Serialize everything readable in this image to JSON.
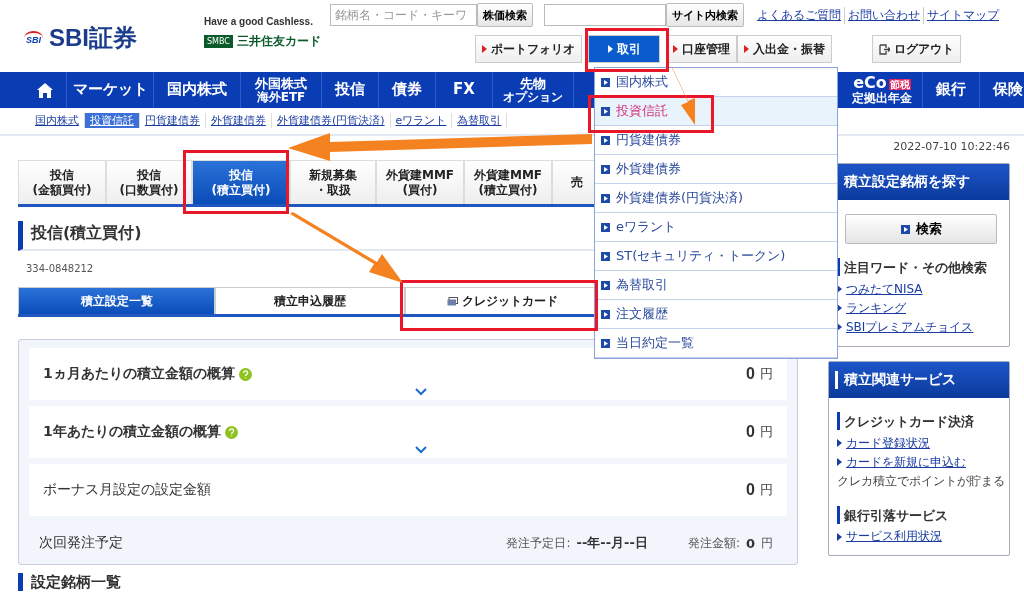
{
  "header": {
    "logo": "SBI証券",
    "logo_mark": "SBI",
    "tagline": "Have a good Cashless.",
    "card_badge": "SMBC",
    "card_brand": "三井住友カード",
    "stock_search": {
      "placeholder": "銘柄名・コード・キーワ",
      "button": "株価検索"
    },
    "site_search": {
      "button": "サイト内検索"
    },
    "links": [
      "よくあるご質問",
      "お問い合わせ",
      "サイトマップ"
    ],
    "menu_buttons": [
      {
        "label": "ポートフォリオ",
        "selected": false
      },
      {
        "label": "取引",
        "selected": true
      },
      {
        "label": "口座管理",
        "selected": false
      },
      {
        "label": "入出金・振替",
        "selected": false
      }
    ],
    "logout": "ログアウト"
  },
  "nav": [
    {
      "kind": "home"
    },
    {
      "kind": "text",
      "label": "マーケット"
    },
    {
      "kind": "text",
      "label": "国内株式"
    },
    {
      "kind": "two",
      "label": "外国株式",
      "sub": "海外ETF"
    },
    {
      "kind": "text",
      "label": "投信"
    },
    {
      "kind": "text",
      "label": "債券"
    },
    {
      "kind": "text",
      "label": "FX"
    },
    {
      "kind": "two",
      "label": "先物",
      "sub": "オプション"
    },
    {
      "kind": "gap"
    },
    {
      "kind": "badge",
      "label": "eCo",
      "badge": "節税",
      "sub": "定拠出年金"
    },
    {
      "kind": "text",
      "label": "銀行"
    },
    {
      "kind": "text",
      "label": "保険"
    }
  ],
  "subnav": [
    {
      "label": "国内株式",
      "selected": false
    },
    {
      "label": "投資信託",
      "selected": true
    },
    {
      "label": "円貨建債券",
      "selected": false
    },
    {
      "label": "外貨建債券",
      "selected": false
    },
    {
      "label": "外貨建債券(円貨決済)",
      "selected": false
    },
    {
      "label": "eワラント",
      "selected": false
    },
    {
      "label": "為替取引",
      "selected": false
    }
  ],
  "dropdown": [
    {
      "label": "国内株式",
      "selected": false
    },
    {
      "label": "投資信託",
      "selected": true
    },
    {
      "label": "円貨建債券",
      "selected": false
    },
    {
      "label": "外貨建債券",
      "selected": false
    },
    {
      "label": "外貨建債券(円貨決済)",
      "selected": false
    },
    {
      "label": "eワラント",
      "selected": false
    },
    {
      "label": "ST(セキュリティ・トークン)",
      "selected": false
    },
    {
      "label": "為替取引",
      "selected": false
    },
    {
      "label": "注文履歴",
      "selected": false
    },
    {
      "label": "当日約定一覧",
      "selected": false
    }
  ],
  "timestamp": "2022-07-10 10:22:46",
  "tabs": [
    {
      "label": "投信",
      "sub": "(金額買付)",
      "selected": false
    },
    {
      "label": "投信",
      "sub": "(口数買付)",
      "selected": false
    },
    {
      "label": "投信",
      "sub": "(積立買付)",
      "selected": true
    },
    {
      "label": "新規募集",
      "sub": "・取扱",
      "selected": false
    },
    {
      "label": "外貨建MMF",
      "sub": "(買付)",
      "selected": false
    },
    {
      "label": "外貨建MMF",
      "sub": "(積立買付)",
      "selected": false
    },
    {
      "label": "売",
      "selected": false
    }
  ],
  "page_title": "投信(積立買付)",
  "account": "334-0848212",
  "subtabs": [
    {
      "label": "積立設定一覧",
      "selected": true,
      "external": false
    },
    {
      "label": "積立申込履歴",
      "selected": false,
      "external": false
    },
    {
      "label": "クレジットカード",
      "selected": false,
      "external": true
    }
  ],
  "summary": {
    "rows": [
      {
        "label": "1ヵ月あたりの積立金額の概算",
        "help": true,
        "expandable": true,
        "value": "0",
        "unit": "円"
      },
      {
        "label": "1年あたりの積立金額の概算",
        "help": true,
        "expandable": true,
        "value": "0",
        "unit": "円"
      },
      {
        "label": "ボーナス月設定の設定金額",
        "help": false,
        "expandable": false,
        "value": "0",
        "unit": "円"
      }
    ],
    "next": {
      "label": "次回発注予定",
      "date_label": "発注予定日:",
      "date": "--年--月--日",
      "amount_label": "発注金額:",
      "amount": "0",
      "unit": "円"
    }
  },
  "section_title": "設定銘柄一覧",
  "sidebar": [
    {
      "title": "積立設定銘柄を探す",
      "button": "検索",
      "groups": [
        {
          "heading": "注目ワード・その他検索",
          "links": [
            "つみたてNISA",
            "ランキング",
            "SBIプレミアムチョイス"
          ]
        }
      ]
    },
    {
      "title": "積立関連サービス",
      "groups": [
        {
          "heading": "クレジットカード決済",
          "links": [
            "カード登録状況",
            "カードを新規に申込む"
          ],
          "note": "クレカ積立でポイントが貯まる"
        },
        {
          "heading": "銀行引落サービス",
          "links": [
            "サービス利用状況"
          ]
        }
      ]
    }
  ]
}
